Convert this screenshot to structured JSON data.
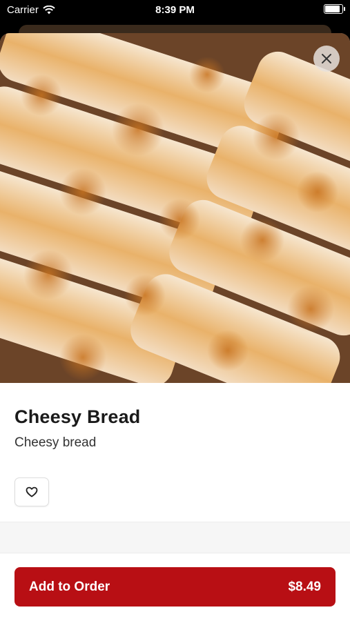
{
  "status_bar": {
    "carrier": "Carrier",
    "time": "8:39 PM",
    "battery_level": 0.95
  },
  "item": {
    "name": "Cheesy Bread",
    "description": "Cheesy bread",
    "image_subject": "baked cheesy breadsticks",
    "favorite_icon": "heart-outline-icon"
  },
  "close_icon": "close-x-icon",
  "order_button": {
    "label": "Add to Order",
    "price": "$8.49"
  },
  "colors": {
    "accent": "#b80f14",
    "cheese": "#e8a14a",
    "crust": "#f2e3d0"
  }
}
